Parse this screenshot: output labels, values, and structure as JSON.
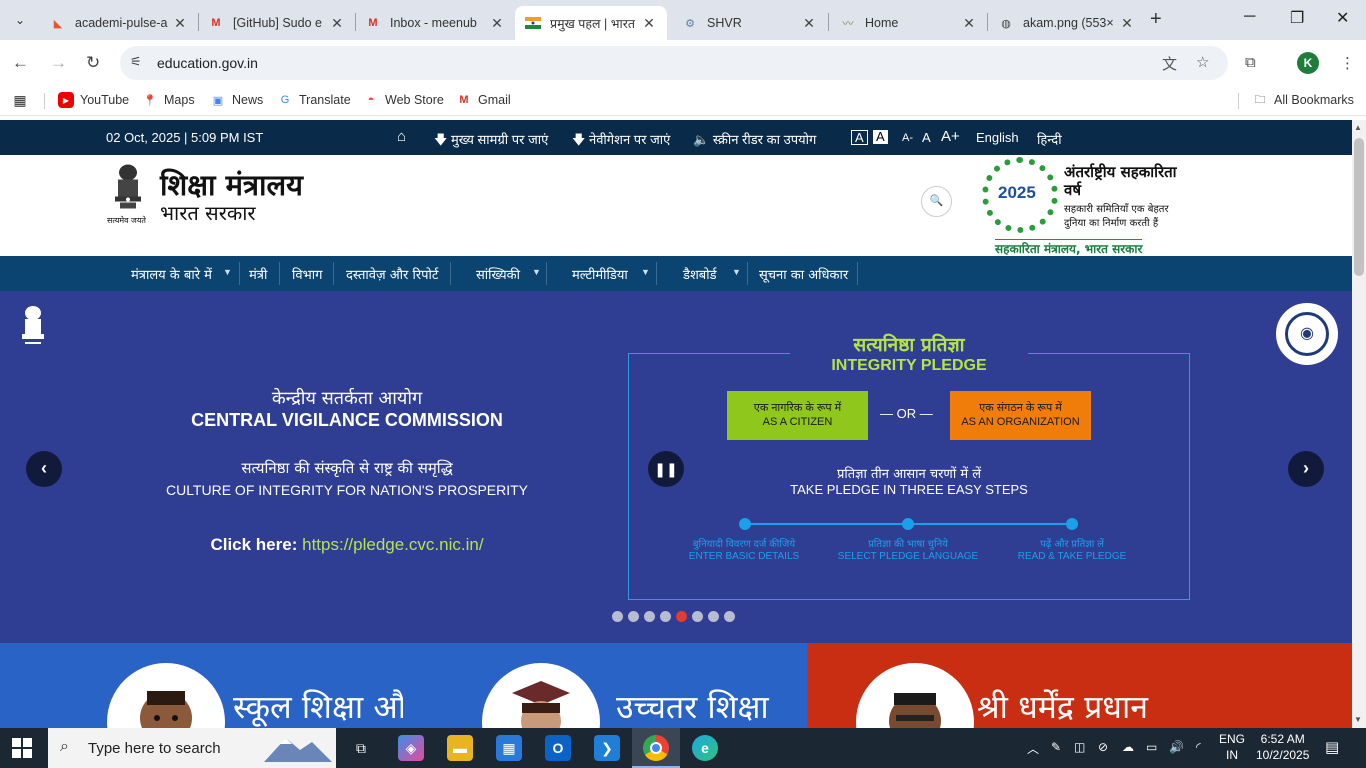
{
  "browser": {
    "tabs": [
      {
        "title": "academi-pulse-a",
        "icon": "github-lab-icon",
        "active": false
      },
      {
        "title": "[GitHub] Sudo e",
        "icon": "gmail-icon",
        "active": false
      },
      {
        "title": "Inbox - meenub",
        "icon": "gmail-icon",
        "active": false
      },
      {
        "title": "प्रमुख पहल | भारत",
        "icon": "india-flag-icon",
        "active": true
      },
      {
        "title": "SHVR",
        "icon": "shvr-icon",
        "active": false
      },
      {
        "title": "Home",
        "icon": "home-leaf-icon",
        "active": false
      },
      {
        "title": "akam.png (553×",
        "icon": "globe-icon",
        "active": false
      }
    ],
    "url": "education.gov.in",
    "profile_initial": "K",
    "bookmarks": [
      "YouTube",
      "Maps",
      "News",
      "Translate",
      "Web Store",
      "Gmail"
    ],
    "all_bookmarks": "All Bookmarks"
  },
  "site": {
    "date_time": "02 Oct, 2025 | 5:09 PM IST",
    "skip_main": "मुख्य सामग्री पर जाएं",
    "skip_nav": "नेवीगेशन पर जाएं",
    "screen_reader": "स्क्रीन रीडर का उपयोग",
    "contrast_a1": "A",
    "contrast_a2": "A",
    "font_minus": "A-",
    "font_normal": "A",
    "font_plus": "A+",
    "lang_en": "English",
    "lang_hi": "हिन्दी",
    "ministry_name": "शिक्षा मंत्रालय",
    "govt_name": "भारत सरकार",
    "emblem_motto": "सत्यमेव जयते",
    "iyc": {
      "year": "2025",
      "title": "अंतर्राष्ट्रीय सहकारिता वर्ष",
      "tagline": "सहकारी समितियाँ एक बेहतर दुनिया का निर्माण करती हैं",
      "footer": "सहकारिता मंत्रालय, भारत सरकार"
    },
    "nav": [
      {
        "label": "मंत्रालय के बारे में",
        "dropdown": true
      },
      {
        "label": "मंत्री",
        "dropdown": false
      },
      {
        "label": "विभाग",
        "dropdown": false
      },
      {
        "label": "दस्तावेज़ और रिपोर्ट",
        "dropdown": false
      },
      {
        "label": "सांख्यिकी",
        "dropdown": true
      },
      {
        "label": "मल्टीमीडिया",
        "dropdown": true
      },
      {
        "label": "डैशबोर्ड",
        "dropdown": true
      },
      {
        "label": "सूचना का अधिकार",
        "dropdown": false
      }
    ],
    "hero": {
      "cvc_hi": "केन्द्रीय सतर्कता आयोग",
      "cvc_en": "CENTRAL VIGILANCE COMMISSION",
      "culture_hi": "सत्यनिष्ठा की संस्कृति से राष्ट्र की समृद्धि",
      "culture_en": "CULTURE OF INTEGRITY FOR NATION'S PROSPERITY",
      "click_here": "Click here:",
      "pledge_url": "https://pledge.cvc.nic.in/",
      "pledge_hi": "सत्यनिष्ठा प्रतिज्ञा",
      "pledge_en": "INTEGRITY PLEDGE",
      "citizen_hi": "एक नागरिक के रूप में",
      "citizen_en": "AS A CITIZEN",
      "or": "— OR —",
      "org_hi": "एक संगठन के रूप में",
      "org_en": "AS AN ORGANIZATION",
      "steps_hi": "प्रतिज्ञा तीन आसान चरणों में लें",
      "steps_en": "TAKE PLEDGE IN THREE EASY STEPS",
      "step1_hi": "बुनियादी विवरण दर्ज कीजिये",
      "step1_en": "ENTER BASIC DETAILS",
      "step2_hi": "प्रतिज्ञा की भाषा चुनिये",
      "step2_en": "SELECT PLEDGE LANGUAGE",
      "step3_hi": "पढ़ें और प्रतिज्ञा लें",
      "step3_en": "READ & TAKE PLEDGE",
      "slide_count": 8,
      "active_slide": 4
    },
    "panels": [
      {
        "title": "स्कूल शिक्षा और",
        "color": "#2a63c6"
      },
      {
        "title": "उच्चतर शिक्षा",
        "color": "#2a63c6"
      },
      {
        "title": "श्री धर्मेंद्र प्रधान",
        "color": "#c92d12"
      }
    ]
  },
  "taskbar": {
    "search_placeholder": "Type here to search",
    "lang_line1": "ENG",
    "lang_line2": "IN",
    "time": "6:52 AM",
    "date": "10/2/2025"
  },
  "colors": {
    "topbar": "#0a2a4a",
    "navbar": "#0b4470",
    "hero_bg": "#2f3d93",
    "pledge_green": "#8fc71c",
    "pledge_orange": "#f07d0a",
    "pledge_accent": "#1aa0e8",
    "active_dot": "#e23b2f"
  }
}
